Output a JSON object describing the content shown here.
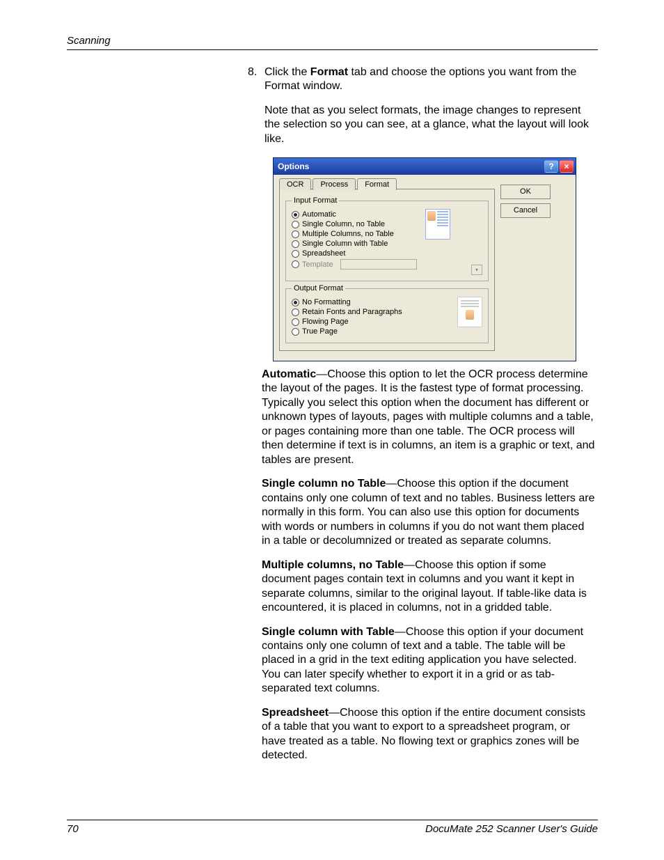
{
  "header": {
    "section": "Scanning"
  },
  "step": {
    "number": "8.",
    "line1a": "Click the ",
    "line1b": "Format",
    "line1c": " tab and choose the options you want from the Format window.",
    "note": "Note that as you select formats, the image changes to represent the selection so you can see, at a glance, what the layout will look like."
  },
  "dialog": {
    "title": "Options",
    "tabs": {
      "ocr": "OCR",
      "process": "Process",
      "format": "Format"
    },
    "input_legend": "Input Format",
    "input_opts": {
      "automatic": "Automatic",
      "single_no_table": "Single Column, no Table",
      "multi_no_table": "Multiple Columns, no Table",
      "single_with_table": "Single Column with Table",
      "spreadsheet": "Spreadsheet",
      "template": "Template"
    },
    "output_legend": "Output Format",
    "output_opts": {
      "no_formatting": "No Formatting",
      "retain": "Retain Fonts and Paragraphs",
      "flowing": "Flowing Page",
      "true_page": "True Page"
    },
    "buttons": {
      "ok": "OK",
      "cancel": "Cancel"
    }
  },
  "defs": {
    "automatic": {
      "term": "Automatic",
      "text": "—Choose this option to let the OCR process determine the layout of the pages. It is the fastest type of format processing. Typically you select this option when the document has different or unknown types of layouts, pages with multiple columns and a table, or pages containing more than one table. The OCR process will then determine if text is in columns, an item is a graphic or text, and tables are present."
    },
    "single_no_table": {
      "term": "Single column no Table",
      "text": "—Choose this option if the document contains only one column of text and no tables. Business letters are normally in this form. You can also use this option for documents with words or numbers in columns if you do not want them placed in a table or decolumnized or treated as separate columns."
    },
    "multi_no_table": {
      "term": "Multiple columns, no Table",
      "text": "—Choose this option if some document pages contain text in columns and you want it kept in separate columns, similar to the original layout. If table-like data is encountered, it is placed in columns, not in a gridded table."
    },
    "single_with_table": {
      "term": "Single column with Table",
      "text": "—Choose this option if your document contains only one column of text and a table. The table will be placed in a grid in the text editing application you have selected. You can later specify whether to export it in a grid or as tab-separated text columns."
    },
    "spreadsheet": {
      "term": "Spreadsheet",
      "text": "—Choose this option if the entire document consists of a table that you want to export to a spreadsheet program, or have treated as a table. No flowing text or graphics zones will be detected."
    }
  },
  "footer": {
    "page": "70",
    "title": "DocuMate 252 Scanner User's Guide"
  }
}
